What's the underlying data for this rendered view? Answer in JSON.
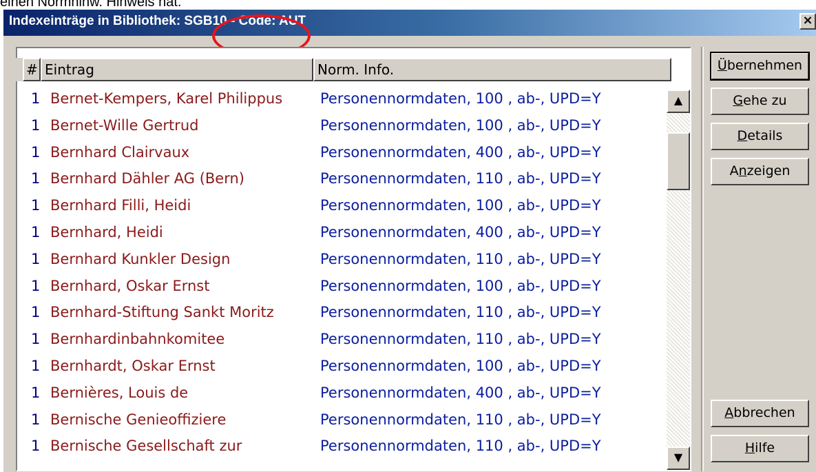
{
  "background_text": "einen Normhinw. Hinweis hat.",
  "window": {
    "title": "Indexeinträge in Bibliothek: SGB10 - Code: AUT",
    "close_label": "×"
  },
  "list": {
    "columns": [
      "#",
      "Eintrag",
      "Norm. Info."
    ],
    "rows": [
      {
        "num": "1",
        "entry": "Bernet-Kempers, Karel Philippus",
        "info": "Personennormdaten, 100 , ab-, UPD=Y"
      },
      {
        "num": "1",
        "entry": "Bernet-Wille Gertrud",
        "info": "Personennormdaten, 100 , ab-, UPD=Y"
      },
      {
        "num": "1",
        "entry": "Bernhard Clairvaux",
        "info": "Personennormdaten, 400 , ab-, UPD=Y"
      },
      {
        "num": "1",
        "entry": "Bernhard Dähler AG (Bern)",
        "info": "Personennormdaten, 110 , ab-, UPD=Y"
      },
      {
        "num": "1",
        "entry": "Bernhard Filli, Heidi",
        "info": "Personennormdaten, 100 , ab-, UPD=Y"
      },
      {
        "num": "1",
        "entry": "Bernhard, Heidi",
        "info": "Personennormdaten, 400 , ab-, UPD=Y"
      },
      {
        "num": "1",
        "entry": "Bernhard Kunkler Design",
        "info": "Personennormdaten, 110 , ab-, UPD=Y"
      },
      {
        "num": "1",
        "entry": "Bernhard, Oskar Ernst",
        "info": "Personennormdaten, 100 , ab-, UPD=Y"
      },
      {
        "num": "1",
        "entry": "Bernhard-Stiftung Sankt Moritz",
        "info": "Personennormdaten, 110 , ab-, UPD=Y"
      },
      {
        "num": "1",
        "entry": "Bernhardinbahnkomitee",
        "info": "Personennormdaten, 110 , ab-, UPD=Y"
      },
      {
        "num": "1",
        "entry": "Bernhardt, Oskar Ernst",
        "info": "Personennormdaten, 100 , ab-, UPD=Y"
      },
      {
        "num": "1",
        "entry": "Bernières, Louis de",
        "info": "Personennormdaten, 400 , ab-, UPD=Y"
      },
      {
        "num": "1",
        "entry": "Bernische Genieoffiziere",
        "info": "Personennormdaten, 110 , ab-, UPD=Y"
      },
      {
        "num": "1",
        "entry": "Bernische Gesellschaft zur",
        "info": "Personennormdaten, 110 , ab-, UPD=Y"
      }
    ]
  },
  "scroll": {
    "up": "▲",
    "down": "▼"
  },
  "buttons": {
    "ubernehmen": {
      "key": "Ü",
      "rest": "bernehmen"
    },
    "gehe_zu": {
      "key": "G",
      "rest": "ehe zu"
    },
    "details": {
      "key": "D",
      "rest": "etails"
    },
    "anzeigen": {
      "pre": "A",
      "key": "n",
      "rest": "zeigen"
    },
    "abbrechen": {
      "key": "A",
      "rest": "bbrechen"
    },
    "hilfe": {
      "key": "H",
      "rest": "ilfe"
    }
  },
  "colors": {
    "title_gradient_start": "#0a246a",
    "entry_text": "#8b1a1a",
    "info_text": "#0a1e9e",
    "highlight_circle": "#e8141c"
  }
}
